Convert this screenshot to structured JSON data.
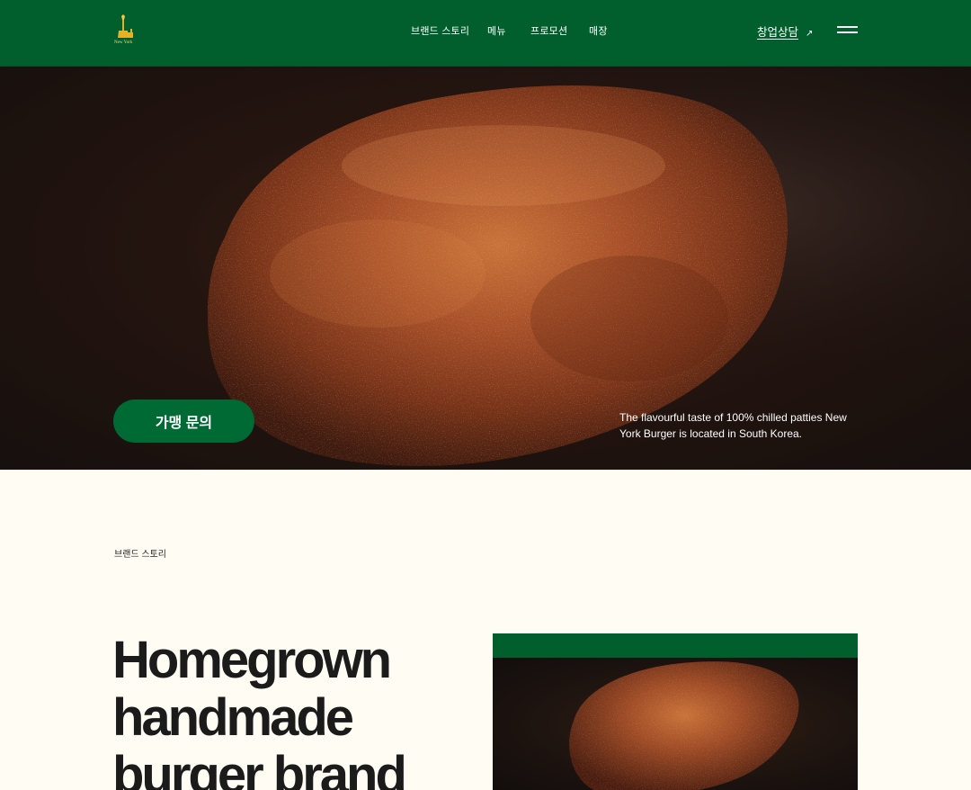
{
  "brand": {
    "logo_text": "New York",
    "logo_icon": "liberty-torch-icon",
    "accent": "#005f2c",
    "logo_color": "#e3b22b"
  },
  "nav": {
    "items": [
      {
        "label": "브랜드 스토리"
      },
      {
        "label": "메뉴"
      },
      {
        "label": "프로모션"
      },
      {
        "label": "매장"
      }
    ],
    "cta_label": "창업상담",
    "cta_arrow": "↗",
    "menu_icon": "hamburger-icon"
  },
  "hero": {
    "button_label": "가맹 문의",
    "caption": "The flavourful taste of 100% chilled patties New York Burger is located in South Korea.",
    "image": "grilled-patty-image"
  },
  "story": {
    "section_label": "브랜드 스토리",
    "headline": "Homegrown handmade burger brand",
    "image": "grilled-patty-image"
  }
}
